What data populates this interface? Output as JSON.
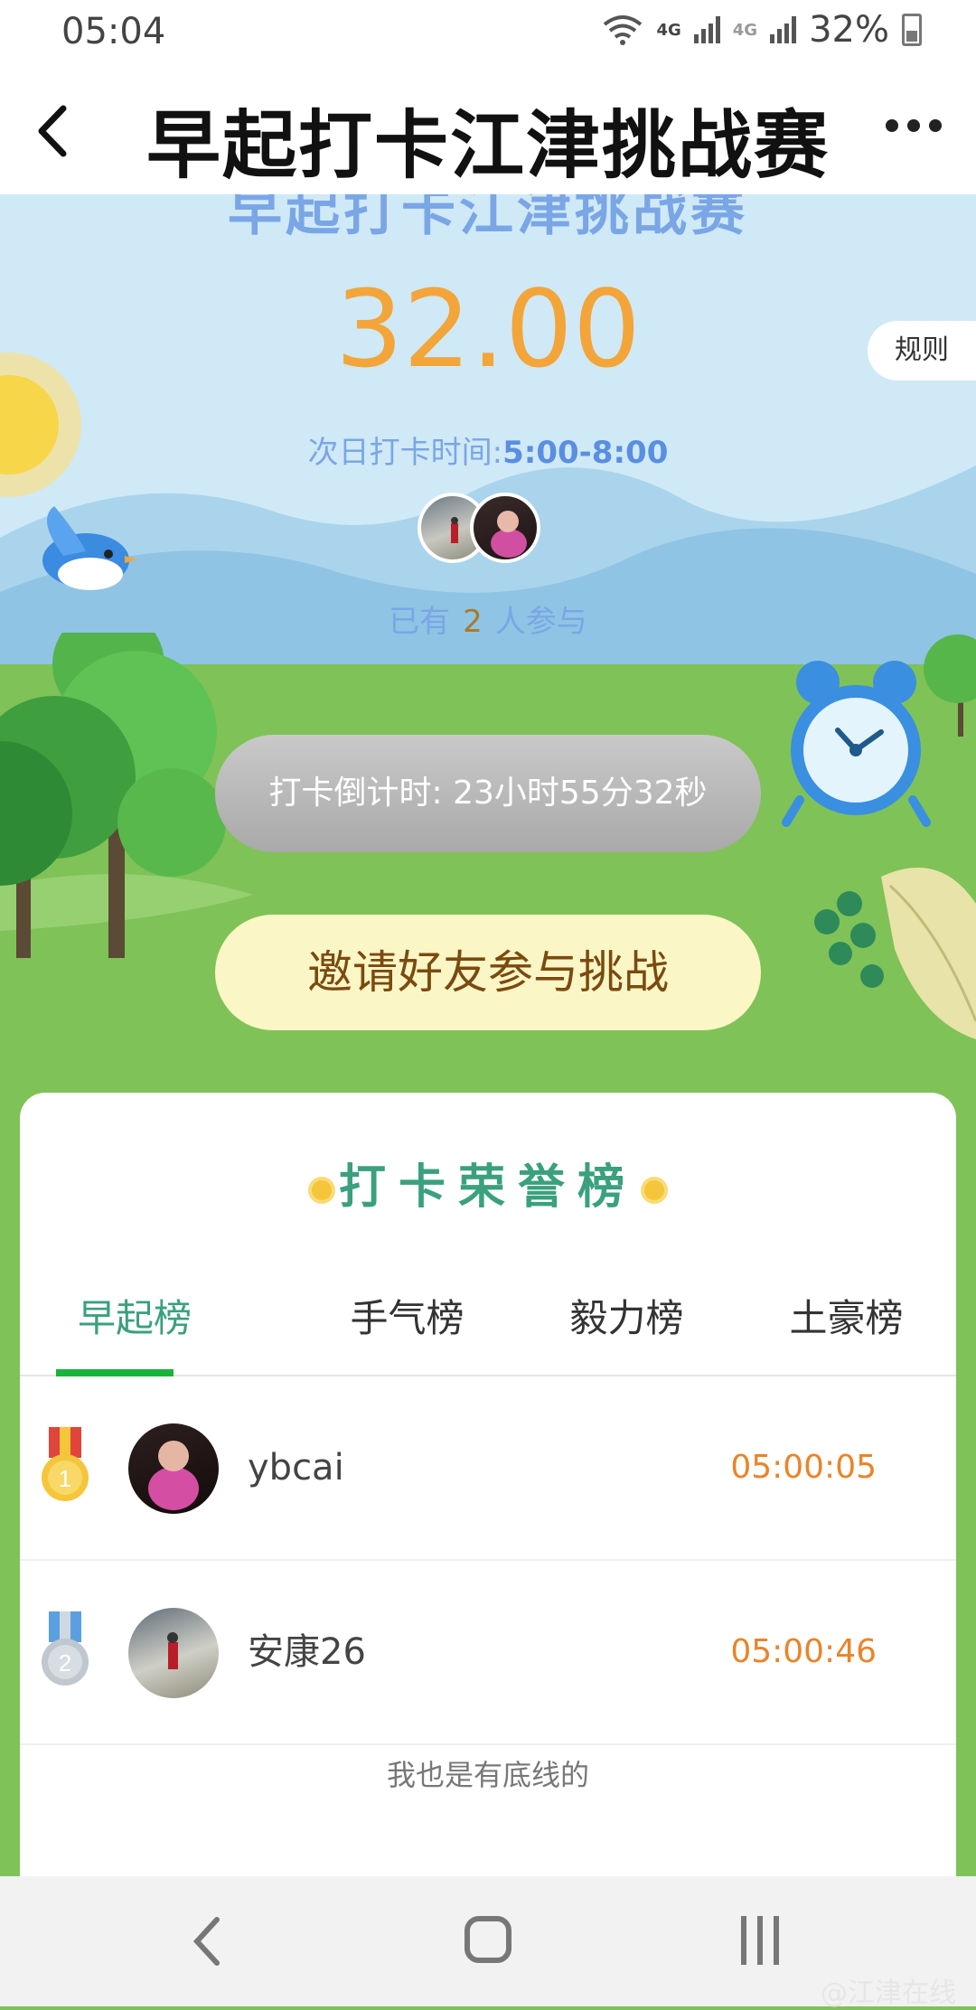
{
  "status": {
    "time": "05:04",
    "network1": "4G",
    "network2": "4G",
    "battery": "32%"
  },
  "header": {
    "title": "早起打卡江津挑战赛"
  },
  "hero": {
    "title": "早起打卡江津挑战赛",
    "amount": "32.00",
    "rule_label": "规则",
    "checkin_label": "次日打卡时间:",
    "checkin_time": "5:00-8:00",
    "participants_prefix": "已有",
    "participants_count": "2",
    "participants_suffix": "人参与"
  },
  "countdown": "打卡倒计时: 23小时55分32秒",
  "invite_label": "邀请好友参与挑战",
  "honor": {
    "title": "打卡荣誉榜",
    "tabs": [
      {
        "label": "早起榜"
      },
      {
        "label": "手气榜"
      },
      {
        "label": "毅力榜"
      },
      {
        "label": "土豪榜"
      }
    ],
    "rows": [
      {
        "rank": "1",
        "name": "ybcai",
        "time": "05:00:05"
      },
      {
        "rank": "2",
        "name": "安康26",
        "time": "05:00:46"
      }
    ],
    "footer": "我也是有底线的"
  },
  "watermark": "@江津在线",
  "colors": {
    "accent_green": "#3aa07d",
    "tab_underline": "#19b33b",
    "amount_orange": "#f3a53a",
    "time_orange": "#e8852a",
    "sky_blue": "#cfe9f6",
    "grass_green": "#7fc258"
  }
}
